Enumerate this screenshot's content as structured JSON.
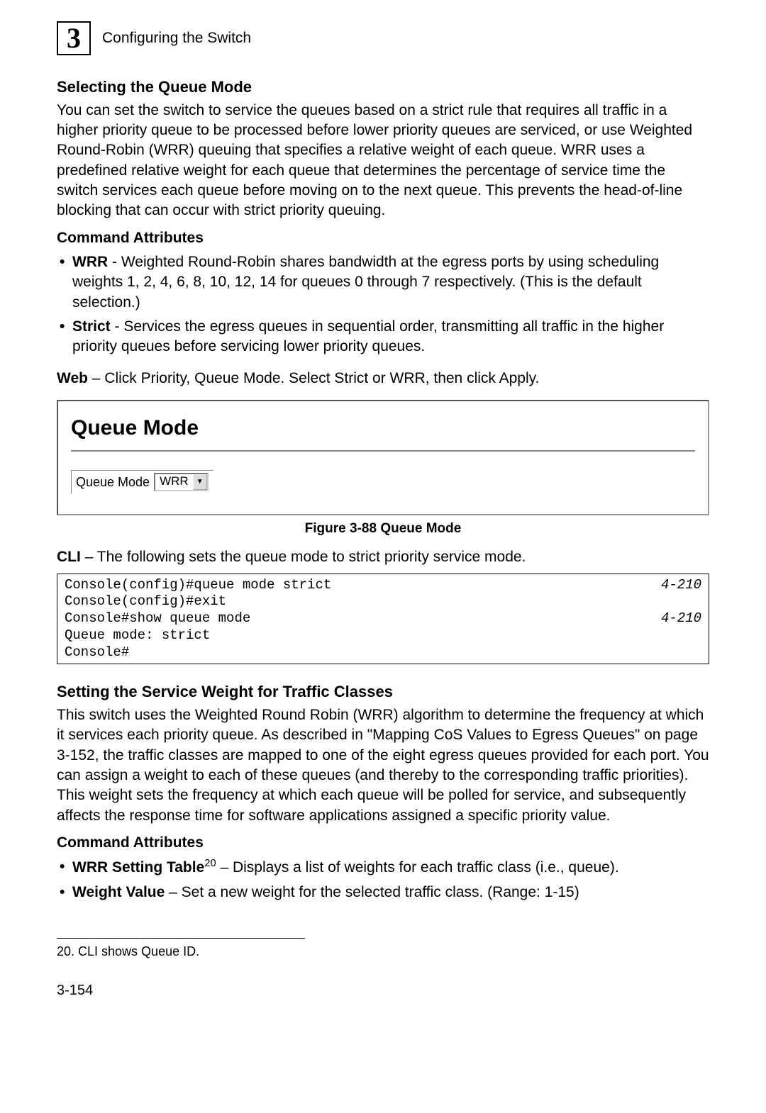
{
  "header": {
    "chapter_number": "3",
    "chapter_title": "Configuring the Switch"
  },
  "section1": {
    "heading": "Selecting the Queue Mode",
    "body": "You can set the switch to service the queues based on a strict rule that requires all traffic in a higher priority queue to be processed before lower priority queues are serviced, or use Weighted Round-Robin (WRR) queuing that specifies a relative weight of each queue. WRR uses a predefined relative weight for each queue that determines the percentage of service time the switch services each queue before moving on to the next queue. This prevents the head-of-line blocking that can occur with strict priority queuing.",
    "cmd_attr_heading": "Command Attributes",
    "bullets": [
      {
        "term": "WRR",
        "desc": " - Weighted Round-Robin shares bandwidth at the egress ports by using scheduling weights 1, 2, 4, 6, 8, 10, 12, 14 for queues 0 through 7 respectively. (This is the default selection.)"
      },
      {
        "term": "Strict",
        "desc": " - Services the egress queues in sequential order, transmitting all traffic in the higher priority queues before servicing lower priority queues."
      }
    ],
    "web_label": "Web",
    "web_text": " – Click Priority, Queue Mode. Select Strict or WRR, then click Apply."
  },
  "figure": {
    "panel_title": "Queue Mode",
    "row_label": "Queue Mode",
    "dropdown_value": "WRR",
    "caption": "Figure 3-88   Queue Mode"
  },
  "cli": {
    "label": "CLI",
    "intro": " – The following sets the queue mode to strict priority service mode.",
    "lines": [
      {
        "text": "Console(config)#queue mode strict",
        "ref": "4-210"
      },
      {
        "text": "Console(config)#exit",
        "ref": ""
      },
      {
        "text": "Console#show queue mode",
        "ref": "4-210"
      },
      {
        "text": " ",
        "ref": ""
      },
      {
        "text": "Queue mode: strict",
        "ref": ""
      },
      {
        "text": "Console#",
        "ref": ""
      }
    ]
  },
  "section2": {
    "heading": "Setting the Service Weight for Traffic Classes",
    "body": "This switch uses the Weighted Round Robin (WRR) algorithm to determine the frequency at which it services each priority queue. As described in \"Mapping CoS Values to Egress Queues\" on page 3-152, the traffic classes are mapped to one of the eight egress queues provided for each port. You can assign a weight to each of these queues (and thereby to the corresponding traffic priorities). This weight sets the frequency at which each queue will be polled for service, and subsequently affects the response time for software applications assigned a specific priority value.",
    "cmd_attr_heading": "Command Attributes",
    "bullets": [
      {
        "term": "WRR Setting Table",
        "sup": "20",
        "desc": " – Displays a list of weights for each traffic class (i.e., queue)."
      },
      {
        "term": "Weight Value",
        "sup": "",
        "desc": " – Set a new weight for the selected traffic class. (Range: 1-15)"
      }
    ]
  },
  "footnote": {
    "text": "20.  CLI shows Queue ID."
  },
  "page_number": "3-154"
}
